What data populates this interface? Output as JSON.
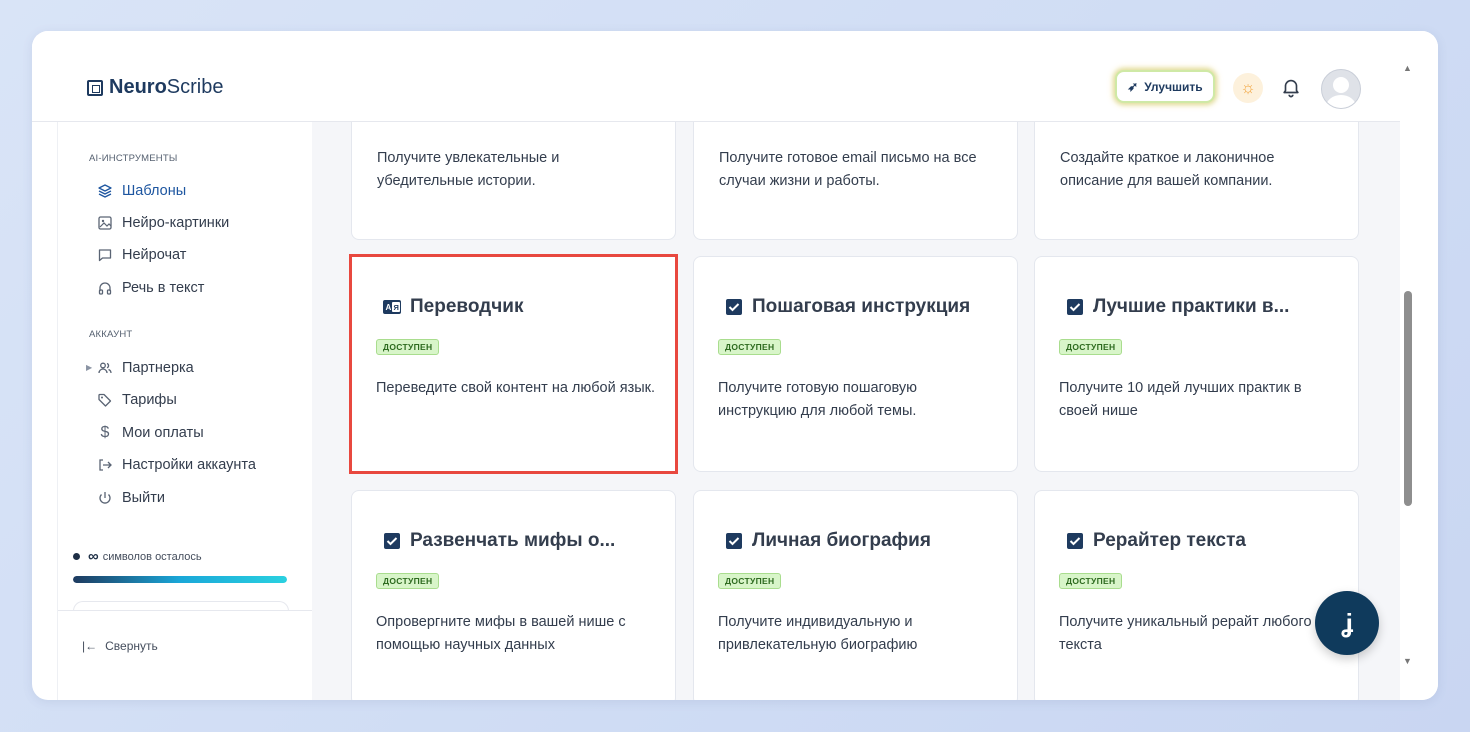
{
  "app": {
    "logo_bold": "Neuro",
    "logo_regular": "Scribe"
  },
  "header": {
    "upgrade_label": "Улучшить"
  },
  "sidebar": {
    "section_tools": "AI-ИНСТРУМЕНТЫ",
    "tools": [
      {
        "label": "Шаблоны",
        "icon": "layers-icon",
        "active": true
      },
      {
        "label": "Нейро-картинки",
        "icon": "image-icon"
      },
      {
        "label": "Нейрочат",
        "icon": "chat-icon"
      },
      {
        "label": "Речь в текст",
        "icon": "headphones-icon"
      }
    ],
    "section_account": "АККАУНТ",
    "account": [
      {
        "label": "Партнерка",
        "icon": "users-icon"
      },
      {
        "label": "Тарифы",
        "icon": "tag-icon"
      },
      {
        "label": "Мои оплаты",
        "icon": "dollar-icon"
      },
      {
        "label": "Настройки аккаунта",
        "icon": "login-icon"
      },
      {
        "label": "Выйти",
        "icon": "power-icon"
      }
    ],
    "credits_symbol": "∞",
    "credits_text": "символов осталось",
    "credits_progress_fraction": 1.0,
    "collapse_label": "Свернуть"
  },
  "cards": {
    "top": [
      {
        "desc": "Получите увлекательные и убедительные истории."
      },
      {
        "desc": "Получите готовое email письмо на все случаи жизни и работы."
      },
      {
        "desc": "Создайте краткое и лаконичное описание для вашей компании."
      }
    ],
    "row2": [
      {
        "title": "Переводчик",
        "badge": "ДОСТУПЕН",
        "desc": "Переведите свой контент на любой язык.",
        "icon": "translate-icon",
        "selected": true
      },
      {
        "title": "Пошаговая инструкция",
        "badge": "ДОСТУПЕН",
        "desc": "Получите готовую пошаговую инструкцию для любой темы.",
        "icon": "checkbox-icon"
      },
      {
        "title": "Лучшие практики в...",
        "badge": "ДОСТУПЕН",
        "desc": "Получите 10 идей лучших практик в своей нише",
        "icon": "checkbox-icon"
      }
    ],
    "row3": [
      {
        "title": "Развенчать мифы о...",
        "badge": "ДОСТУПЕН",
        "desc": "Опровергните мифы в вашей нише с помощью научных данных",
        "icon": "checkbox-icon"
      },
      {
        "title": "Личная биография",
        "badge": "ДОСТУПЕН",
        "desc": "Получите индивидуальную и привлекательную биографию",
        "icon": "checkbox-icon"
      },
      {
        "title": "Рерайтер текста",
        "badge": "ДОСТУПЕН",
        "desc": "Получите уникальный рерайт любого текста",
        "icon": "checkbox-icon"
      }
    ]
  },
  "fab": {
    "glyph": "ʝ"
  },
  "colors": {
    "brand": "#1e3a5f",
    "active": "#1e56a0",
    "highlight": "#e8483f",
    "badge_bg": "#d8f5c9",
    "fab": "#0f3a5c"
  }
}
